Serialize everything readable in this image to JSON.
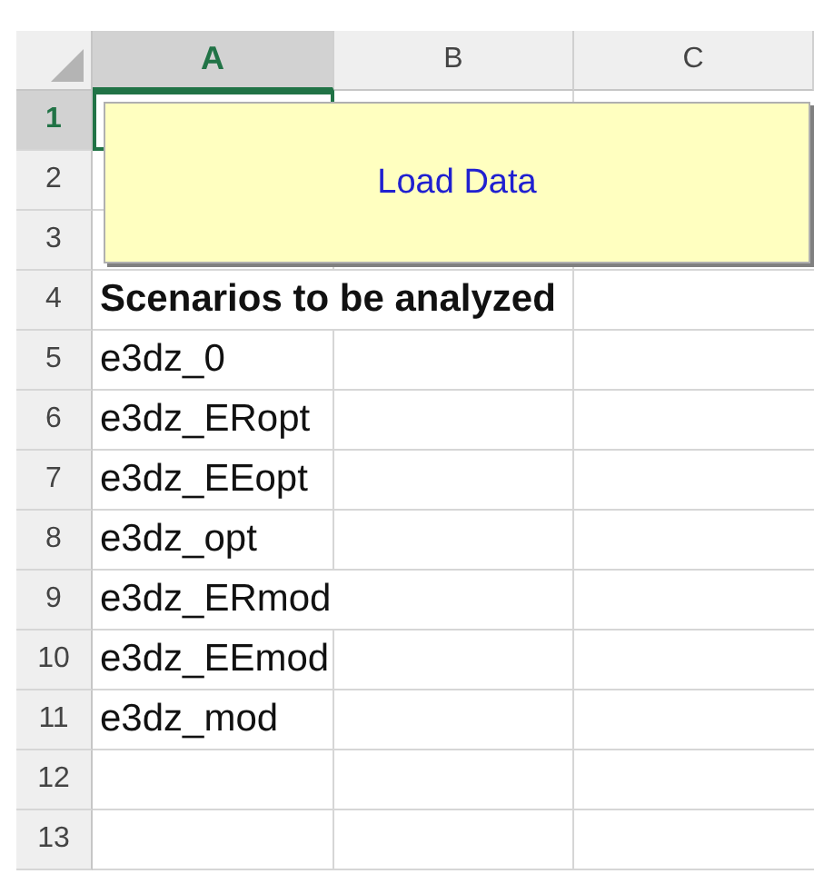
{
  "columns": [
    {
      "label": "A",
      "selected": true
    },
    {
      "label": "B",
      "selected": false
    },
    {
      "label": "C",
      "selected": false
    }
  ],
  "rows": [
    {
      "number": "1",
      "selected": true,
      "cells": []
    },
    {
      "number": "2",
      "selected": false,
      "cells": []
    },
    {
      "number": "3",
      "selected": false,
      "cells": []
    },
    {
      "number": "4",
      "selected": false,
      "cells": [
        {
          "text": "Scenarios to be analyzed",
          "kind": "header"
        }
      ]
    },
    {
      "number": "5",
      "selected": false,
      "cells": [
        {
          "text": "e3dz_0",
          "kind": "value"
        }
      ]
    },
    {
      "number": "6",
      "selected": false,
      "cells": [
        {
          "text": "e3dz_ERopt",
          "kind": "value"
        }
      ]
    },
    {
      "number": "7",
      "selected": false,
      "cells": [
        {
          "text": "e3dz_EEopt",
          "kind": "value"
        }
      ]
    },
    {
      "number": "8",
      "selected": false,
      "cells": [
        {
          "text": "e3dz_opt",
          "kind": "value"
        }
      ]
    },
    {
      "number": "9",
      "selected": false,
      "cells": [
        {
          "text": "e3dz_ERmod",
          "kind": "value"
        }
      ]
    },
    {
      "number": "10",
      "selected": false,
      "cells": [
        {
          "text": "e3dz_EEmod",
          "kind": "value"
        }
      ]
    },
    {
      "number": "11",
      "selected": false,
      "cells": [
        {
          "text": "e3dz_mod",
          "kind": "value"
        }
      ]
    },
    {
      "number": "12",
      "selected": false,
      "cells": []
    },
    {
      "number": "13",
      "selected": false,
      "cells": []
    }
  ],
  "button": {
    "label": "Load Data"
  }
}
